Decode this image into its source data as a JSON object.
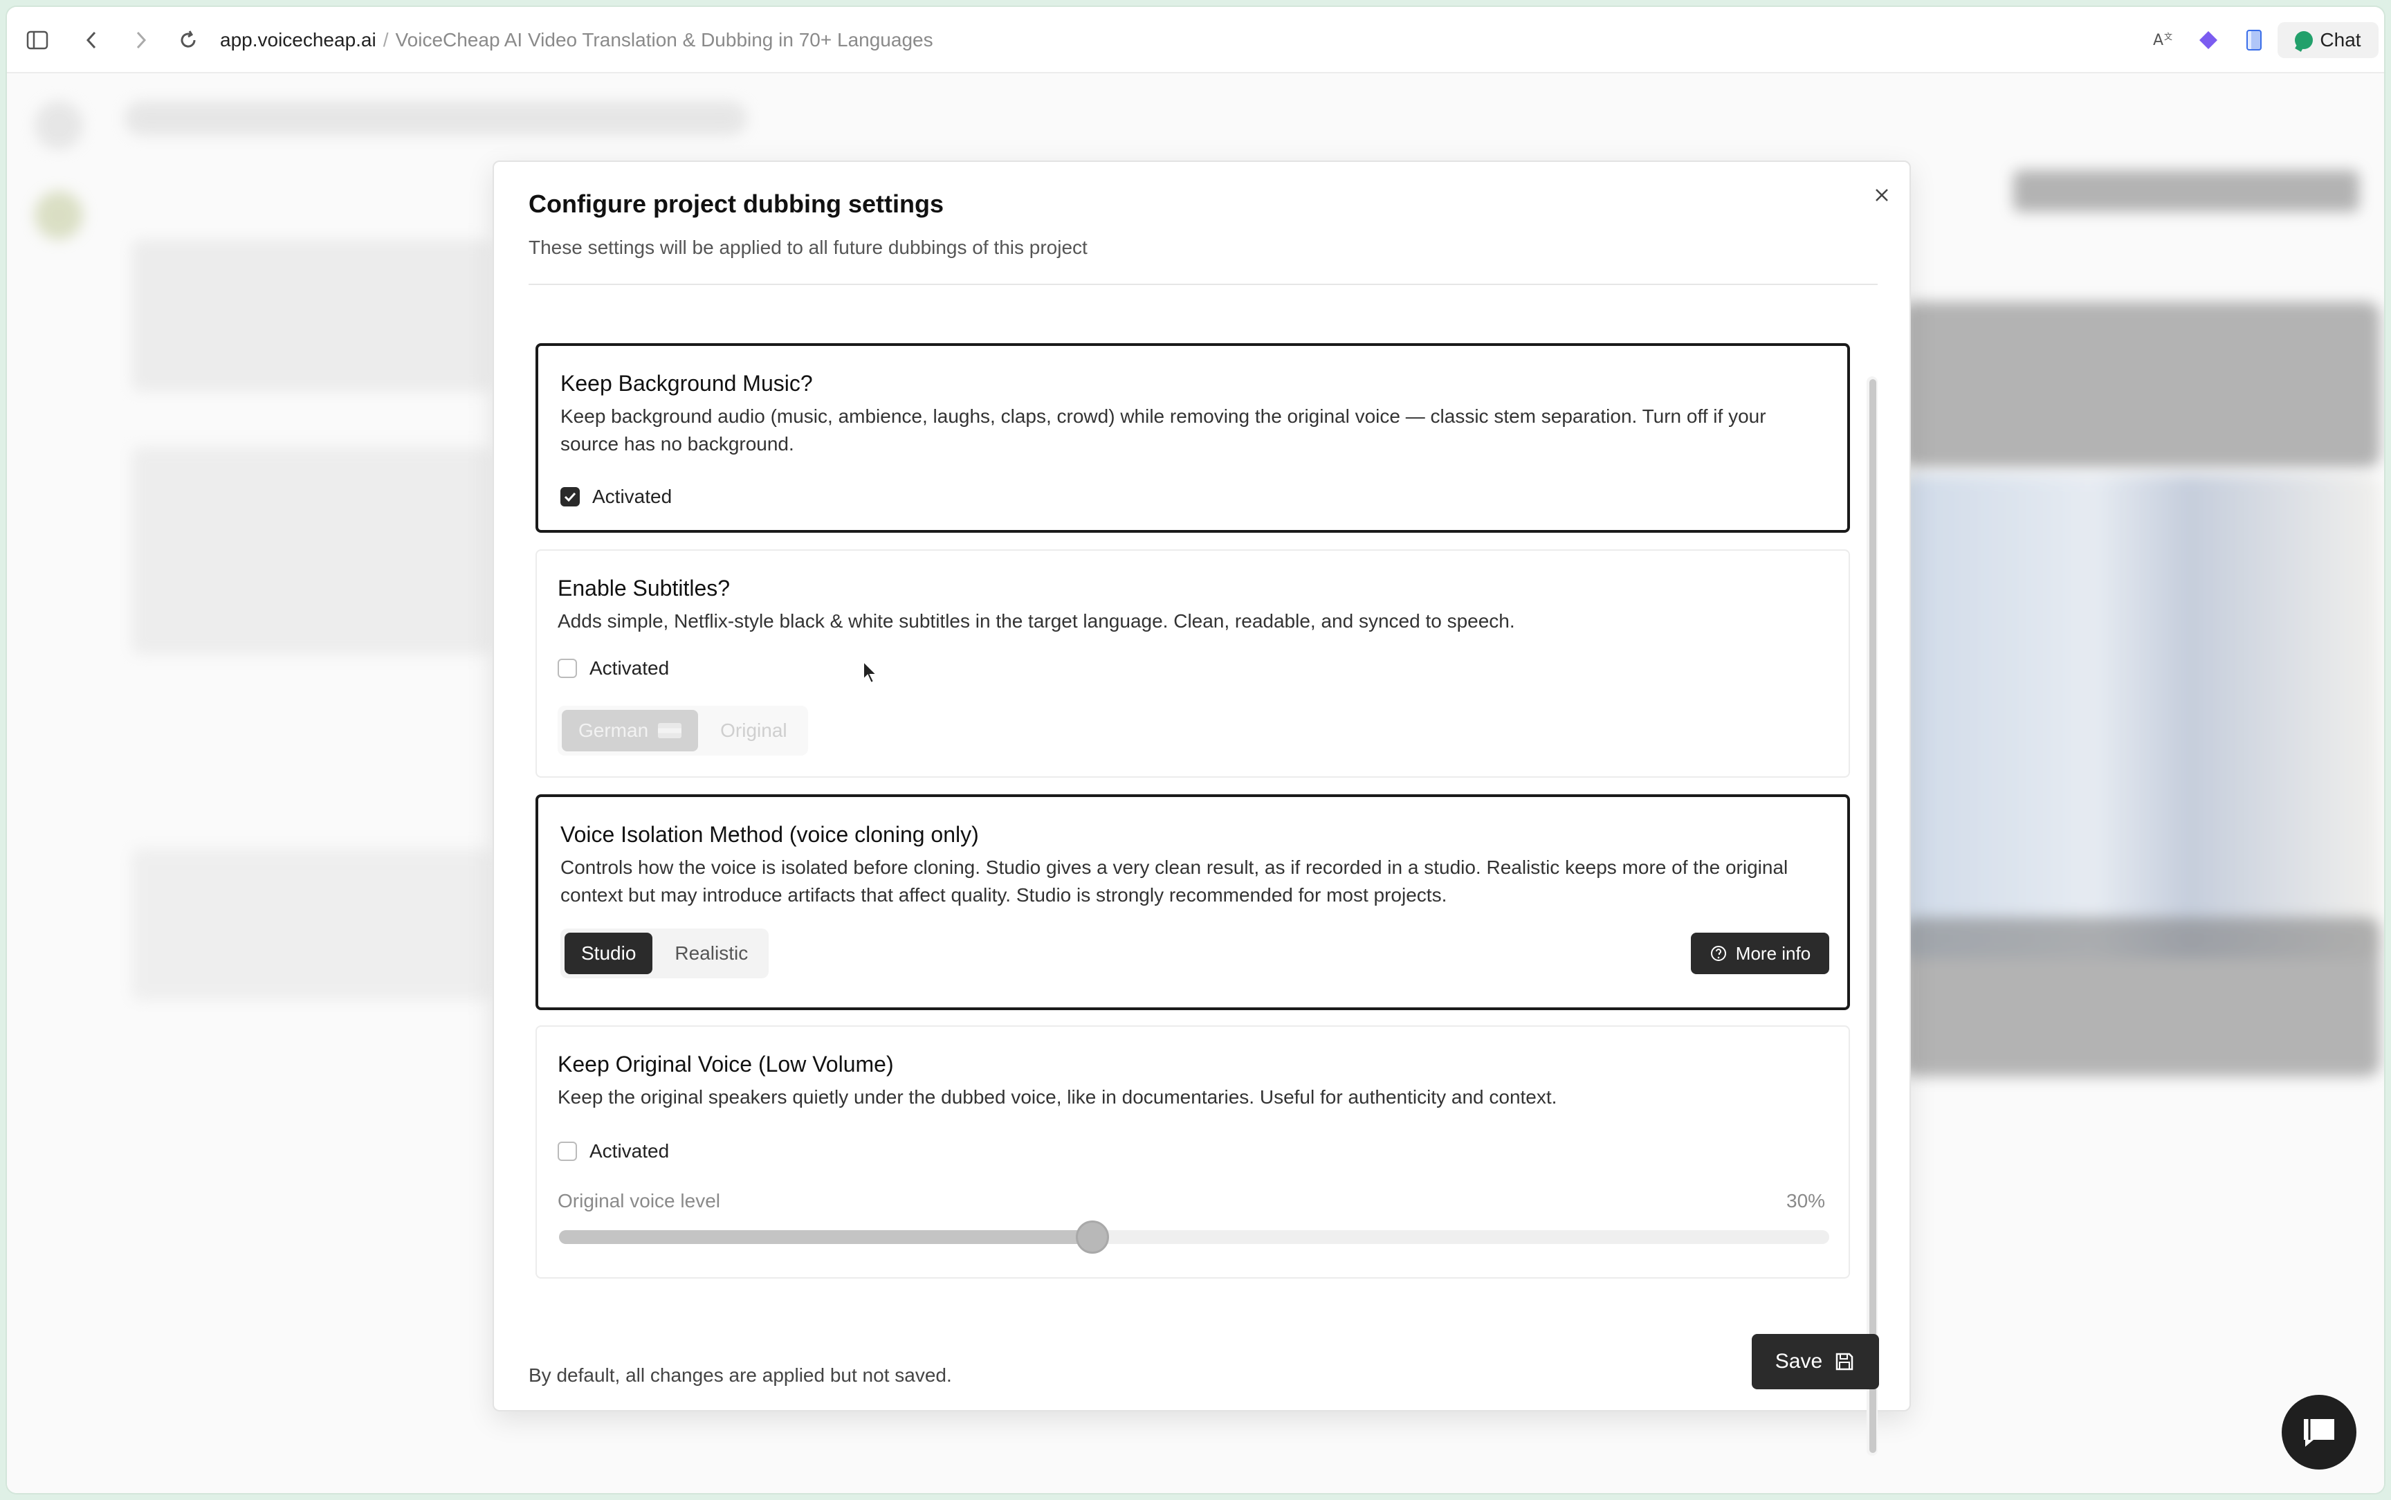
{
  "browser": {
    "host": "app.voicecheap.ai",
    "separator": "/",
    "page_title": "VoiceCheap AI Video Translation & Dubbing in 70+ Languages",
    "chat_label": "Chat"
  },
  "modal": {
    "title": "Configure project dubbing settings",
    "subtitle": "These settings will be applied to all future dubbings of this project",
    "footer_note": "By default, all changes are applied but not saved.",
    "save_label": "Save",
    "sections": {
      "background_music": {
        "title": "Keep Background Music?",
        "description": "Keep background audio (music, ambience, laughs, claps, crowd) while removing the original voice — classic stem separation. Turn off if your source has no background.",
        "checkbox_label": "Activated",
        "checked": true
      },
      "subtitles": {
        "title": "Enable Subtitles?",
        "description": "Adds simple, Netflix-style black & white subtitles in the target language. Clean, readable, and synced to speech.",
        "checkbox_label": "Activated",
        "checked": false,
        "options": [
          "German",
          "Original"
        ],
        "selected": "German"
      },
      "voice_isolation": {
        "title": "Voice Isolation Method (voice cloning only)",
        "description": "Controls how the voice is isolated before cloning. Studio gives a very clean result, as if recorded in a studio. Realistic keeps more of the original context but may introduce artifacts that affect quality. Studio is strongly recommended for most projects.",
        "options": [
          "Studio",
          "Realistic"
        ],
        "selected": "Studio",
        "more_info_label": "More info"
      },
      "original_voice": {
        "title": "Keep Original Voice (Low Volume)",
        "description": "Keep the original speakers quietly under the dubbed voice, like in documentaries. Useful for authenticity and context.",
        "checkbox_label": "Activated",
        "checked": false,
        "slider_label": "Original voice level",
        "slider_value_text": "30%",
        "slider_fraction": 0.42
      }
    }
  }
}
